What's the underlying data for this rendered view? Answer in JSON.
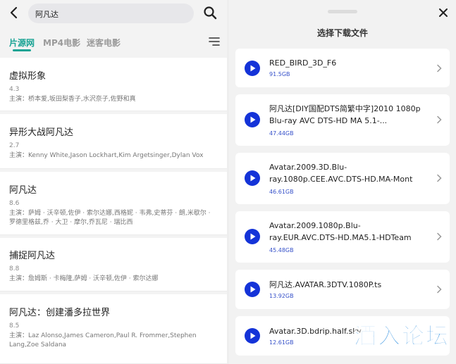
{
  "search": {
    "query": "阿凡达"
  },
  "tabs": [
    {
      "label": "片源网"
    },
    {
      "label": "MP4电影"
    },
    {
      "label": "迷客电影"
    }
  ],
  "results": [
    {
      "title": "虚拟形象",
      "score": "4.3",
      "cast": "主演：桥本爱,坂田梨香子,水沢奈子,佐野和真"
    },
    {
      "title": "异形大战阿凡达",
      "score": "2.7",
      "cast": "主演：Kenny White,Jason Lockhart,Kim Argetsinger,Dylan Vox"
    },
    {
      "title": "阿凡达",
      "score": "8.6",
      "cast": "主演：萨姆 · 沃辛顿,佐伊 · 索尔达娜,西格妮 · 韦弗,史蒂芬 · 朗,米歇尔 · 罗德里格兹,乔 · 大卫 · 摩尔,乔瓦尼 · 瑞比西"
    },
    {
      "title": "捕捉阿凡达",
      "score": "8.8",
      "cast": "主演：詹姆斯 · 卡梅隆,萨姆 · 沃辛顿,佐伊 · 索尔达娜"
    },
    {
      "title": "阿凡达：创建潘多拉世界",
      "score": "8.5",
      "cast": "主演：Laz Alonso,James Cameron,Paul R. Frommer,Stephen Lang,Zoe Saldana"
    }
  ],
  "sheet": {
    "title": "选择下载文件"
  },
  "files": [
    {
      "name": "RED_BIRD_3D_F6",
      "size": "91.5GB"
    },
    {
      "name": "阿凡达[DIY国配DTS简繁中字]2010 1080p Blu-ray AVC DTS-HD MA 5.1-...",
      "size": "47.44GB"
    },
    {
      "name": "Avatar.2009.3D.Blu-ray.1080p.CEE.AVC.DTS-HD.MA-Mont",
      "size": "46.61GB"
    },
    {
      "name": "Avatar.2009.1080p.Blu-ray.EUR.AVC.DTS-HD.MA5.1-HDTeam",
      "size": "45.48GB"
    },
    {
      "name": "阿凡达.AVATAR.3DTV.1080P.ts",
      "size": "13.92GB"
    },
    {
      "name": "Avatar.3D.bdrip.half.sky",
      "size": "12.61GB"
    }
  ],
  "watermark": {
    "text": "酒入论坛"
  },
  "colors": {
    "accent": "#19a394",
    "play": "#1433d8",
    "size": "#3550c9"
  }
}
